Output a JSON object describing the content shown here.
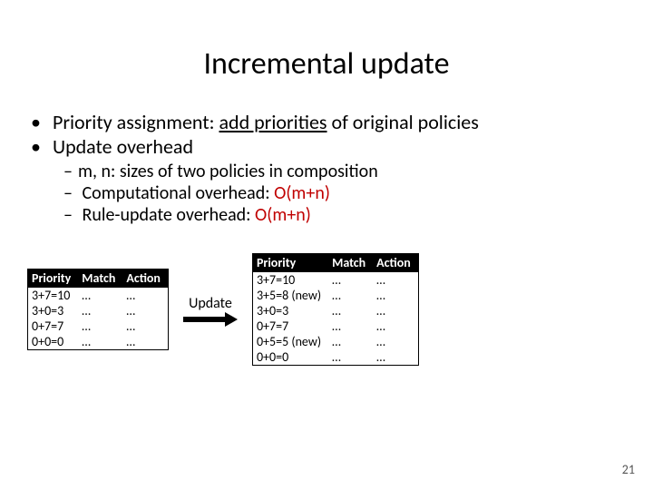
{
  "title": "Incremental update",
  "bullets": {
    "b1_prefix": "Priority assignment: ",
    "b1_underlined": "add priorities",
    "b1_suffix": " of original policies",
    "b2": "Update overhead",
    "sub1": "m, n: sizes of two policies in composition",
    "sub2_prefix": "Computational overhead: ",
    "sub2_red": "O(m+n)",
    "sub3_prefix": "Rule-update overhead: ",
    "sub3_red": "O(m+n)"
  },
  "arrow_label": "Update",
  "headers": {
    "priority": "Priority",
    "match": "Match",
    "action": "Action"
  },
  "left_rows": [
    {
      "priority": "3+7=10",
      "match": "…",
      "action": "…"
    },
    {
      "priority": "3+0=3",
      "match": "…",
      "action": "…"
    },
    {
      "priority": "0+7=7",
      "match": "…",
      "action": "…"
    },
    {
      "priority": "0+0=0",
      "match": "…",
      "action": "…"
    }
  ],
  "right_rows": [
    {
      "priority": "3+7=10",
      "match": "…",
      "action": "…"
    },
    {
      "priority": "3+5=8 (new)",
      "match": "…",
      "action": "…"
    },
    {
      "priority": "3+0=3",
      "match": "…",
      "action": "…"
    },
    {
      "priority": "0+7=7",
      "match": "…",
      "action": "…"
    },
    {
      "priority": "0+5=5 (new)",
      "match": "…",
      "action": "…"
    },
    {
      "priority": "0+0=0",
      "match": "…",
      "action": "…"
    }
  ],
  "page_number": "21"
}
